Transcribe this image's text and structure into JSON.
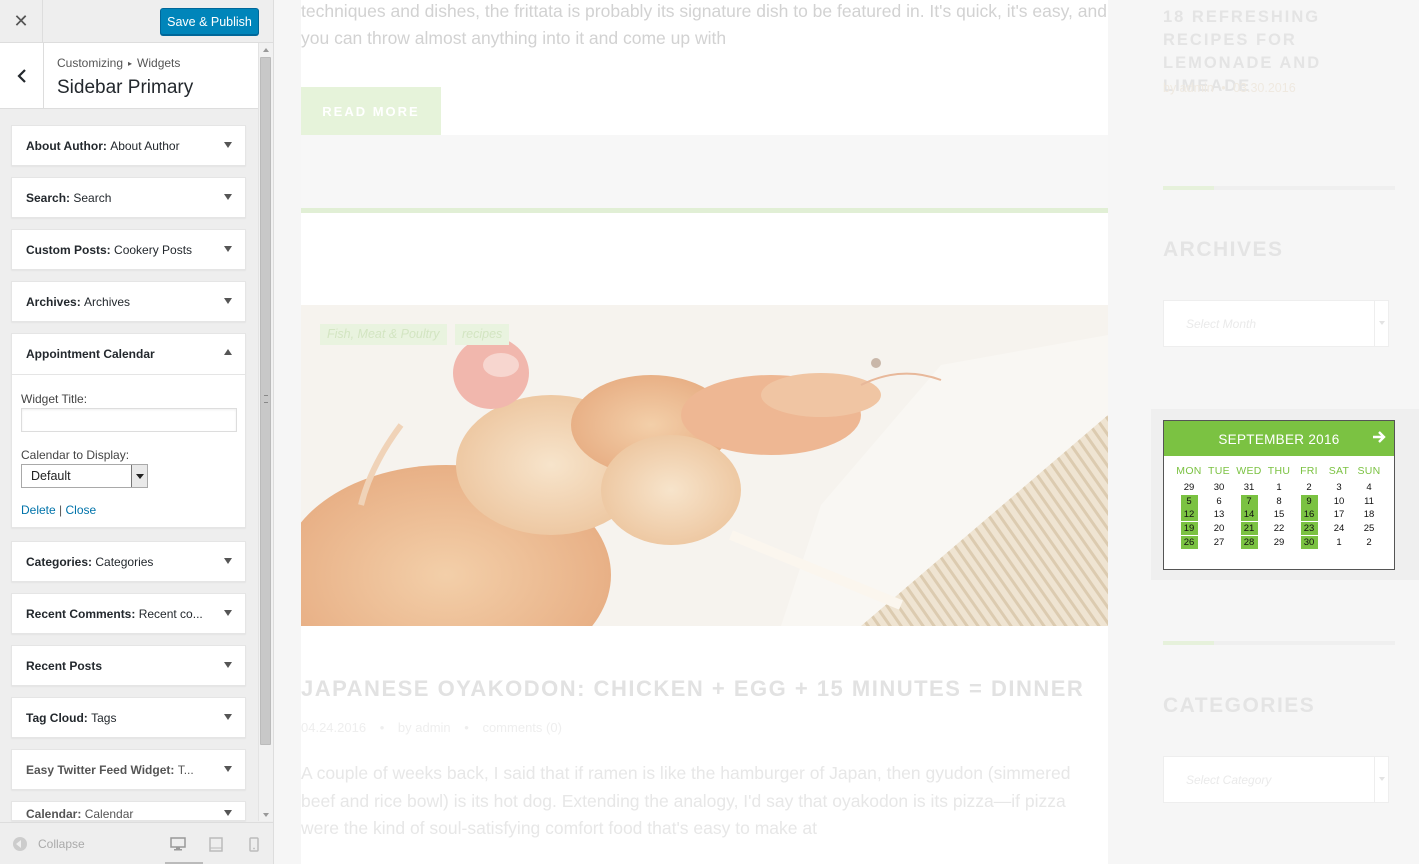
{
  "customizer": {
    "close_label": "✕",
    "publish_label": "Save & Publish",
    "breadcrumb": {
      "root": "Customizing",
      "separator": "▸",
      "section": "Widgets"
    },
    "panel_title": "Sidebar Primary",
    "widgets": [
      {
        "name": "About Author:",
        "sub": "About Author"
      },
      {
        "name": "Search:",
        "sub": "Search"
      },
      {
        "name": "Custom Posts:",
        "sub": "Cookery Posts"
      },
      {
        "name": "Archives:",
        "sub": "Archives"
      },
      {
        "name": "Appointment Calendar",
        "sub": ""
      },
      {
        "name": "Categories:",
        "sub": "Categories"
      },
      {
        "name": "Recent Comments:",
        "sub": "Recent co..."
      },
      {
        "name": "Recent Posts",
        "sub": ""
      },
      {
        "name": "Tag Cloud:",
        "sub": "Tags"
      },
      {
        "name": "Easy Twitter Feed Widget:",
        "sub": "T..."
      },
      {
        "name": "Calendar:",
        "sub": "Calendar"
      }
    ],
    "open_widget": {
      "title_label": "Widget Title:",
      "title_value": "",
      "calendar_label": "Calendar to Display:",
      "calendar_value": "Default",
      "delete_label": "Delete",
      "pipe": "|",
      "close_label": "Close"
    },
    "footer": {
      "collapse_label": "Collapse"
    }
  },
  "preview": {
    "top_excerpt": "techniques and dishes, the frittata is probably its signature dish to be featured in. It's quick, it's easy, and you can throw almost anything into it and come up with",
    "read_more": "READ MORE",
    "post": {
      "tags": [
        "Fish, Meat & Poultry",
        "recipes"
      ],
      "title": "JAPANESE OYAKODON: CHICKEN + EGG + 15 MINUTES = DINNER",
      "date": "04.24.2016",
      "author": "by admin",
      "bullet": "•",
      "comments": "comments (0)",
      "excerpt": "A couple of weeks back, I said that if ramen is like the hamburger of Japan, then gyudon (simmered beef and rice bowl) is its hot dog. Extending the analogy, I'd say that oyakodon is its pizza—if pizza were the kind of soul-satisfying comfort food that's easy to make at"
    },
    "sidebar": {
      "recent_title": "18 REFRESHING RECIPES FOR LEMONADE AND LIMEADE",
      "recent_author": "by admin",
      "recent_date": "03.30.2016",
      "archives_heading": "ARCHIVES",
      "archives_placeholder": "Select Month",
      "categories_heading": "CATEGORIES",
      "categories_placeholder": "Select Category"
    },
    "calendar": {
      "month": "SEPTEMBER 2016",
      "day_headers": [
        "MON",
        "TUE",
        "WED",
        "THU",
        "FRI",
        "SAT",
        "SUN"
      ],
      "weeks": [
        [
          "29",
          "30",
          "31",
          "1",
          "2",
          "3",
          "4"
        ],
        [
          "5",
          "6",
          "7",
          "8",
          "9",
          "10",
          "11"
        ],
        [
          "12",
          "13",
          "14",
          "15",
          "16",
          "17",
          "18"
        ],
        [
          "19",
          "20",
          "21",
          "22",
          "23",
          "24",
          "25"
        ],
        [
          "26",
          "27",
          "28",
          "29",
          "30",
          "1",
          "2"
        ]
      ],
      "available_columns": [
        0,
        2,
        4
      ],
      "available_from_week": 1,
      "accent_color": "#7bc242"
    }
  }
}
